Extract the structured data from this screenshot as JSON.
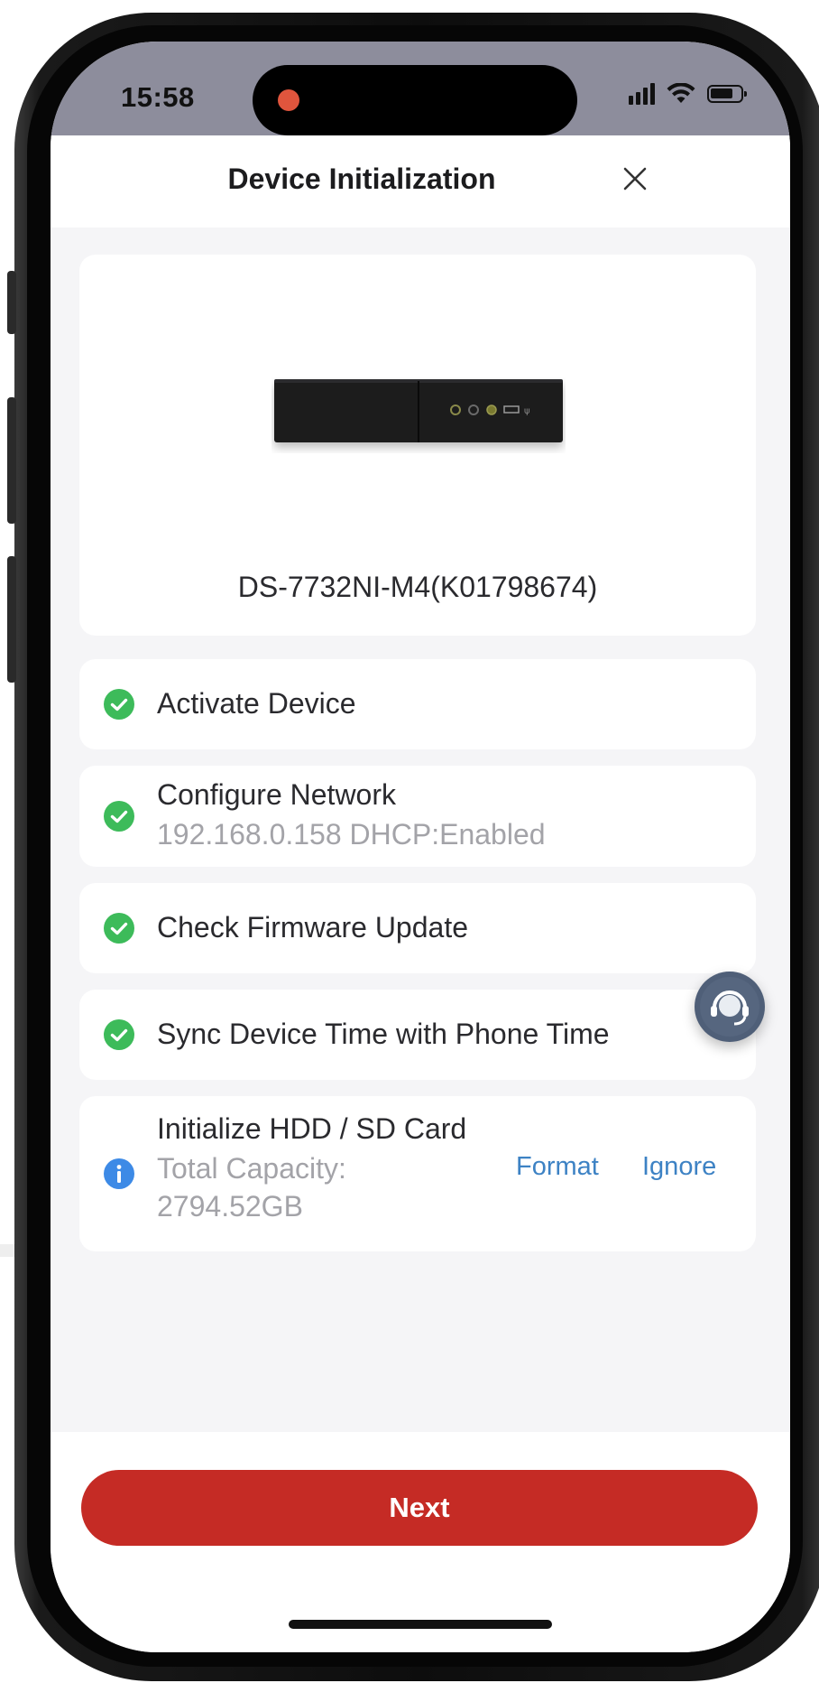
{
  "status_bar": {
    "time": "15:58",
    "icons": [
      "signal-icon",
      "wifi-icon",
      "battery-icon"
    ],
    "recording_indicator_color": "#e0553d"
  },
  "header": {
    "title": "Device Initialization",
    "close_icon": "close-icon"
  },
  "device": {
    "name": "DS-7732NI-M4(K01798674)"
  },
  "steps": [
    {
      "title": "Activate Device",
      "status": "done"
    },
    {
      "title": "Configure Network",
      "subtitle": "192.168.0.158 DHCP:Enabled",
      "status": "done"
    },
    {
      "title": "Check Firmware Update",
      "status": "done"
    },
    {
      "title": "Sync Device Time with Phone Time",
      "status": "done"
    },
    {
      "title": "Initialize HDD / SD Card",
      "subtitle_line1": "Total Capacity:",
      "subtitle_line2": "2794.52GB",
      "status": "info",
      "actions": {
        "format": "Format",
        "ignore": "Ignore"
      }
    }
  ],
  "footer": {
    "next_label": "Next"
  },
  "colors": {
    "accent_red": "#c52b25",
    "success_green": "#3dbb5a",
    "info_blue": "#3d8ae6",
    "link_blue": "#3d82c4"
  }
}
